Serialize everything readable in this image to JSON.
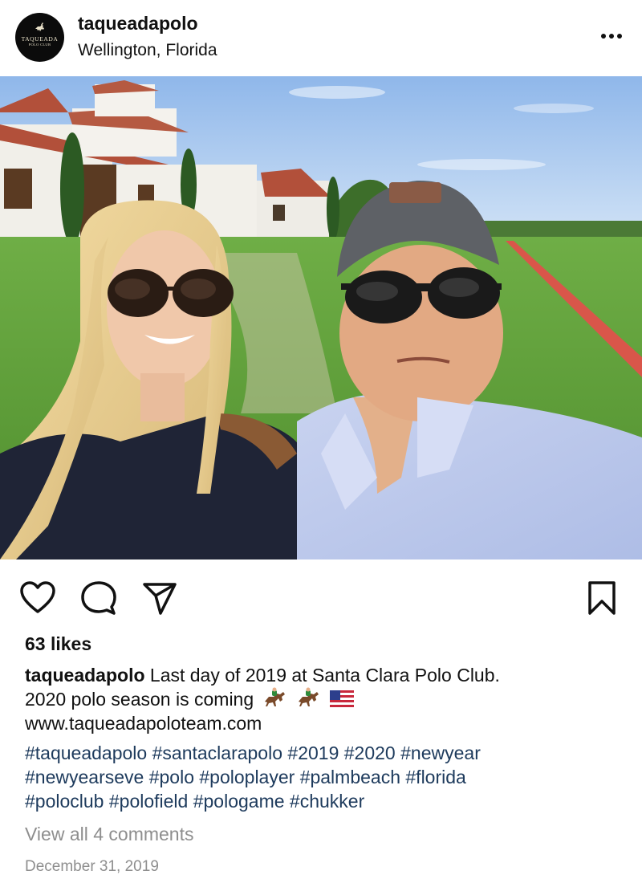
{
  "header": {
    "avatar": {
      "logo_text": "TAQUEADA",
      "logo_subtext": "POLO CLUB",
      "icon": "horse-rider-icon"
    },
    "username": "taqueadapolo",
    "location": "Wellington, Florida",
    "more_icon": "more-horizontal-icon"
  },
  "post": {
    "image_description": "selfie-couple-polo-field"
  },
  "actions": {
    "like_icon": "heart-icon",
    "comment_icon": "comment-bubble-icon",
    "share_icon": "paper-plane-icon",
    "save_icon": "bookmark-icon"
  },
  "likes": "63 likes",
  "caption": {
    "username": "taqueadapolo",
    "line1_text": "Last day of 2019 at Santa Clara Polo Club.",
    "line2_text": "2020 polo season is coming",
    "emojis": [
      "horse-racing-emoji",
      "horse-racing-emoji",
      "us-flag-emoji"
    ],
    "link": "www.taqueadapoloteam.com"
  },
  "hashtags": {
    "line1": [
      "#taqueadapolo",
      "#santaclarapolo",
      "#2019",
      "#2020",
      "#newyear"
    ],
    "line2": [
      "#newyearseve",
      "#polo",
      "#poloplayer",
      "#palmbeach",
      "#florida"
    ],
    "line3": [
      "#poloclub",
      "#polofield",
      "#pologame",
      "#chukker"
    ]
  },
  "comments_link": "View all 4 comments",
  "date": "December 31, 2019",
  "colors": {
    "text": "#111111",
    "hashtag": "#1d3a5c",
    "muted": "#8e8e8e",
    "avatar_bg": "#0b0b0b"
  }
}
